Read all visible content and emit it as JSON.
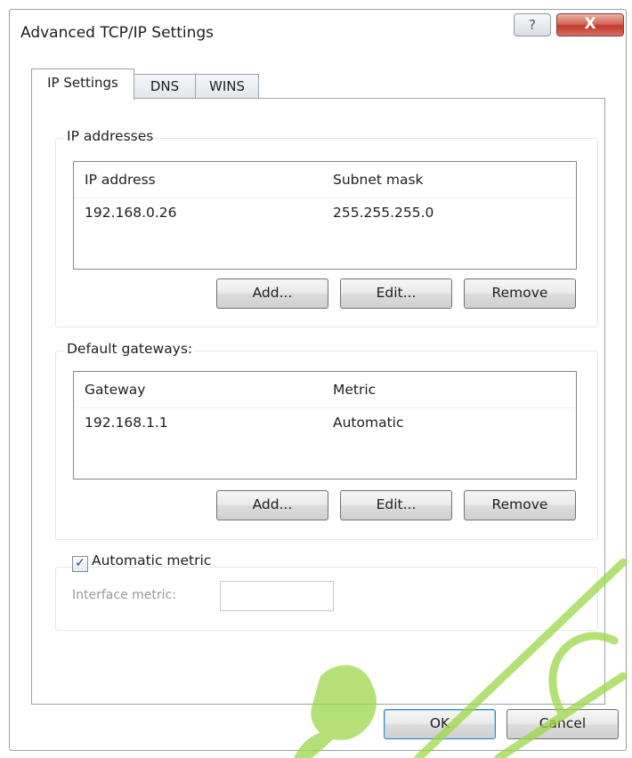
{
  "window": {
    "title": "Advanced TCP/IP Settings",
    "help_glyph": "?",
    "close_glyph": "X"
  },
  "tabs": [
    {
      "label": "IP Settings",
      "active": true
    },
    {
      "label": "DNS",
      "active": false
    },
    {
      "label": "WINS",
      "active": false
    }
  ],
  "ip_addresses": {
    "group_label": "IP addresses",
    "columns": [
      "IP address",
      "Subnet mask"
    ],
    "rows": [
      {
        "address": "192.168.0.26",
        "mask": "255.255.255.0"
      }
    ],
    "buttons": {
      "add": "Add...",
      "edit": "Edit...",
      "remove": "Remove"
    }
  },
  "default_gateways": {
    "group_label": "Default gateways:",
    "columns": [
      "Gateway",
      "Metric"
    ],
    "rows": [
      {
        "gateway": "192.168.1.1",
        "metric": "Automatic"
      }
    ],
    "buttons": {
      "add": "Add...",
      "edit": "Edit...",
      "remove": "Remove"
    }
  },
  "metric": {
    "automatic_label": "Automatic metric",
    "automatic_checked": true,
    "check_glyph": "✓",
    "interface_label": "Interface metric:",
    "interface_value": ""
  },
  "footer": {
    "ok": "OK",
    "cancel": "Cancel"
  },
  "colors": {
    "close_button": "#c0392b",
    "watermark": "#9bd84a",
    "default_button_border": "#3c7fb1"
  }
}
